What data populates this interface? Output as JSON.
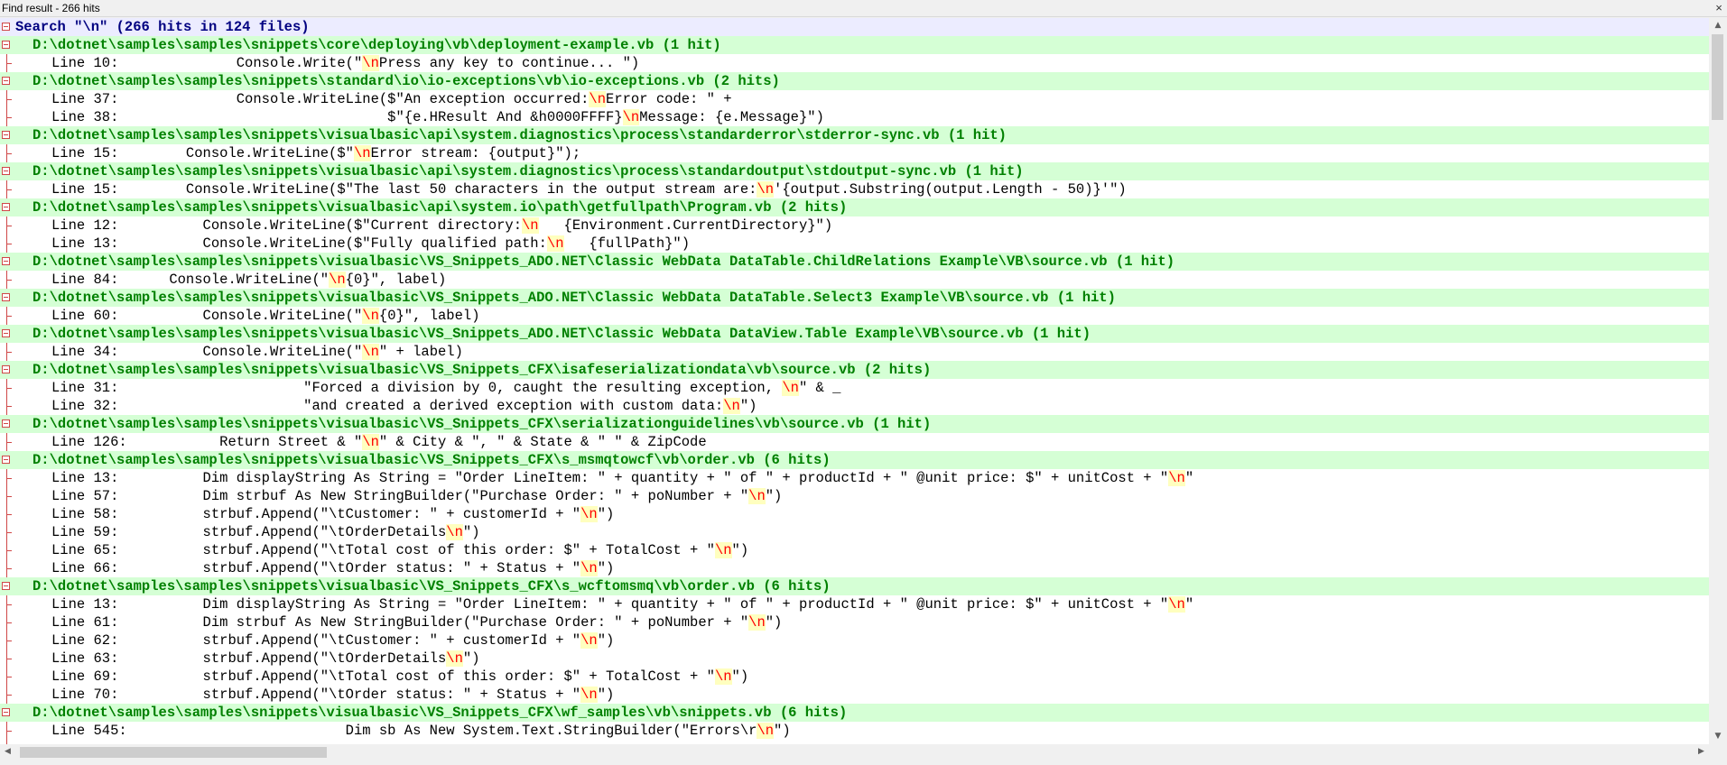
{
  "window": {
    "title": "Find result - 266 hits",
    "close_glyph": "×"
  },
  "search_header": "Search \"\\n\" (266 hits in 124 files)",
  "highlight_term": "\\n",
  "rows": [
    {
      "type": "search",
      "text": "Search \"\\n\" (266 hits in 124 files)"
    },
    {
      "type": "file",
      "text": "D:\\dotnet\\samples\\samples\\snippets\\core\\deploying\\vb\\deployment-example.vb (1 hit)"
    },
    {
      "type": "hit",
      "line": "Line 10:",
      "code": "            Console.Write(\"\\nPress any key to continue... \")"
    },
    {
      "type": "file",
      "text": "D:\\dotnet\\samples\\samples\\snippets\\standard\\io\\io-exceptions\\vb\\io-exceptions.vb (2 hits)"
    },
    {
      "type": "hit",
      "line": "Line 37:",
      "code": "            Console.WriteLine($\"An exception occurred:\\nError code: \" +"
    },
    {
      "type": "hit",
      "line": "Line 38:",
      "code": "                              $\"{e.HResult And &h0000FFFF}\\nMessage: {e.Message}\")"
    },
    {
      "type": "file",
      "text": "D:\\dotnet\\samples\\samples\\snippets\\visualbasic\\api\\system.diagnostics\\process\\standarderror\\stderror-sync.vb (1 hit)"
    },
    {
      "type": "hit",
      "line": "Line 15:",
      "code": "      Console.WriteLine($\"\\nError stream: {output}\");"
    },
    {
      "type": "file",
      "text": "D:\\dotnet\\samples\\samples\\snippets\\visualbasic\\api\\system.diagnostics\\process\\standardoutput\\stdoutput-sync.vb (1 hit)"
    },
    {
      "type": "hit",
      "line": "Line 15:",
      "code": "      Console.WriteLine($\"The last 50 characters in the output stream are:\\n'{output.Substring(output.Length - 50)}'\")"
    },
    {
      "type": "file",
      "text": "D:\\dotnet\\samples\\samples\\snippets\\visualbasic\\api\\system.io\\path\\getfullpath\\Program.vb (2 hits)"
    },
    {
      "type": "hit",
      "line": "Line 12:",
      "code": "        Console.WriteLine($\"Current directory:\\n   {Environment.CurrentDirectory}\")"
    },
    {
      "type": "hit",
      "line": "Line 13:",
      "code": "        Console.WriteLine($\"Fully qualified path:\\n   {fullPath}\")"
    },
    {
      "type": "file",
      "text": "D:\\dotnet\\samples\\samples\\snippets\\visualbasic\\VS_Snippets_ADO.NET\\Classic WebData DataTable.ChildRelations Example\\VB\\source.vb (1 hit)"
    },
    {
      "type": "hit",
      "line": "Line 84:",
      "code": "    Console.WriteLine(\"\\n{0}\", label)"
    },
    {
      "type": "file",
      "text": "D:\\dotnet\\samples\\samples\\snippets\\visualbasic\\VS_Snippets_ADO.NET\\Classic WebData DataTable.Select3 Example\\VB\\source.vb (1 hit)"
    },
    {
      "type": "hit",
      "line": "Line 60:",
      "code": "        Console.WriteLine(\"\\n{0}\", label)"
    },
    {
      "type": "file",
      "text": "D:\\dotnet\\samples\\samples\\snippets\\visualbasic\\VS_Snippets_ADO.NET\\Classic WebData DataView.Table Example\\VB\\source.vb (1 hit)"
    },
    {
      "type": "hit",
      "line": "Line 34:",
      "code": "        Console.WriteLine(\"\\n\" + label)"
    },
    {
      "type": "file",
      "text": "D:\\dotnet\\samples\\samples\\snippets\\visualbasic\\VS_Snippets_CFX\\isafeserializationdata\\vb\\source.vb (2 hits)"
    },
    {
      "type": "hit",
      "line": "Line 31:",
      "code": "                    \"Forced a division by 0, caught the resulting exception, \\n\" & _"
    },
    {
      "type": "hit",
      "line": "Line 32:",
      "code": "                    \"and created a derived exception with custom data:\\n\")"
    },
    {
      "type": "file",
      "text": "D:\\dotnet\\samples\\samples\\snippets\\visualbasic\\VS_Snippets_CFX\\serializationguidelines\\vb\\source.vb (1 hit)"
    },
    {
      "type": "hit",
      "line": "Line 126:",
      "code": "          Return Street & \"\\n\" & City & \", \" & State & \" \" & ZipCode"
    },
    {
      "type": "file",
      "text": "D:\\dotnet\\samples\\samples\\snippets\\visualbasic\\VS_Snippets_CFX\\s_msmqtowcf\\vb\\order.vb (6 hits)"
    },
    {
      "type": "hit",
      "line": "Line 13:",
      "code": "        Dim displayString As String = \"Order LineItem: \" + quantity + \" of \" + productId + \" @unit price: $\" + unitCost + \"\\n\""
    },
    {
      "type": "hit",
      "line": "Line 57:",
      "code": "        Dim strbuf As New StringBuilder(\"Purchase Order: \" + poNumber + \"\\n\")"
    },
    {
      "type": "hit",
      "line": "Line 58:",
      "code": "        strbuf.Append(\"\\tCustomer: \" + customerId + \"\\n\")"
    },
    {
      "type": "hit",
      "line": "Line 59:",
      "code": "        strbuf.Append(\"\\tOrderDetails\\n\")"
    },
    {
      "type": "hit",
      "line": "Line 65:",
      "code": "        strbuf.Append(\"\\tTotal cost of this order: $\" + TotalCost + \"\\n\")"
    },
    {
      "type": "hit",
      "line": "Line 66:",
      "code": "        strbuf.Append(\"\\tOrder status: \" + Status + \"\\n\")"
    },
    {
      "type": "file",
      "text": "D:\\dotnet\\samples\\samples\\snippets\\visualbasic\\VS_Snippets_CFX\\s_wcftomsmq\\vb\\order.vb (6 hits)"
    },
    {
      "type": "hit",
      "line": "Line 13:",
      "code": "        Dim displayString As String = \"Order LineItem: \" + quantity + \" of \" + productId + \" @unit price: $\" + unitCost + \"\\n\""
    },
    {
      "type": "hit",
      "line": "Line 61:",
      "code": "        Dim strbuf As New StringBuilder(\"Purchase Order: \" + poNumber + \"\\n\")"
    },
    {
      "type": "hit",
      "line": "Line 62:",
      "code": "        strbuf.Append(\"\\tCustomer: \" + customerId + \"\\n\")"
    },
    {
      "type": "hit",
      "line": "Line 63:",
      "code": "        strbuf.Append(\"\\tOrderDetails\\n\")"
    },
    {
      "type": "hit",
      "line": "Line 69:",
      "code": "        strbuf.Append(\"\\tTotal cost of this order: $\" + TotalCost + \"\\n\")"
    },
    {
      "type": "hit",
      "line": "Line 70:",
      "code": "        strbuf.Append(\"\\tOrder status: \" + Status + \"\\n\")"
    },
    {
      "type": "file",
      "text": "D:\\dotnet\\samples\\samples\\snippets\\visualbasic\\VS_Snippets_CFX\\wf_samples\\vb\\snippets.vb (6 hits)"
    },
    {
      "type": "hit",
      "line": "Line 545:",
      "code": "                         Dim sb As New System.Text.StringBuilder(\"Errors\\r\\n\")"
    }
  ],
  "scrollbars": {
    "up_icon": "▲",
    "down_icon": "▼",
    "left_icon": "◀",
    "right_icon": "▶"
  },
  "colors": {
    "search_header_bg": "#ececff",
    "search_header_text": "#000080",
    "file_row_bg": "#d5ffd5",
    "file_row_text": "#008000",
    "match_bg": "#ffffbf",
    "match_text": "#ff0000",
    "fold_margin": "#d04848"
  }
}
